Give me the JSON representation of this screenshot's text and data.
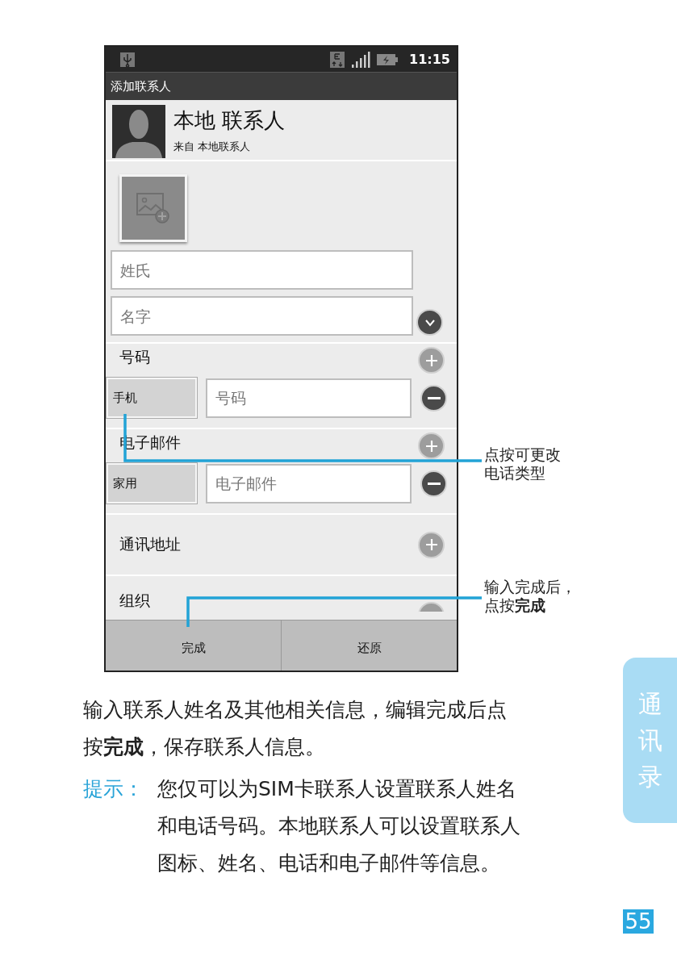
{
  "status_bar": {
    "time": "11:15"
  },
  "window": {
    "title": "添加联系人"
  },
  "account": {
    "name": "本地 联系人",
    "source": "来自 本地联系人"
  },
  "name_fields": [
    {
      "placeholder": "姓氏"
    },
    {
      "placeholder": "名字"
    }
  ],
  "sections": [
    {
      "kind": "list",
      "title": "号码",
      "entries": [
        {
          "type": "手机",
          "placeholder": "号码"
        }
      ]
    },
    {
      "kind": "list",
      "title": "电子邮件",
      "entries": [
        {
          "type": "家用",
          "placeholder": "电子邮件"
        }
      ]
    },
    {
      "kind": "single",
      "title": "通讯地址"
    },
    {
      "kind": "cut",
      "title": "组织"
    }
  ],
  "buttons": [
    "完成",
    "还原"
  ],
  "callouts": [
    {
      "lines": [
        "点按可更改",
        "电话类型"
      ]
    },
    {
      "lines": [
        "输入完成后，",
        "点按**完成**"
      ]
    }
  ],
  "body": {
    "paragraph_lines": [
      "输入联系人姓名及其他相关信息，编辑完成后点",
      "按**完成**，保存联系人信息。"
    ],
    "tip_label": "提示：",
    "tip_lines": [
      "您仅可以为SIM卡联系人设置联系人姓名",
      "和电话号码。本地联系人可以设置联系人",
      "图标、姓名、电话和电子邮件等信息。"
    ]
  },
  "side_tab": {
    "text": "通讯录"
  },
  "page_number": "55"
}
